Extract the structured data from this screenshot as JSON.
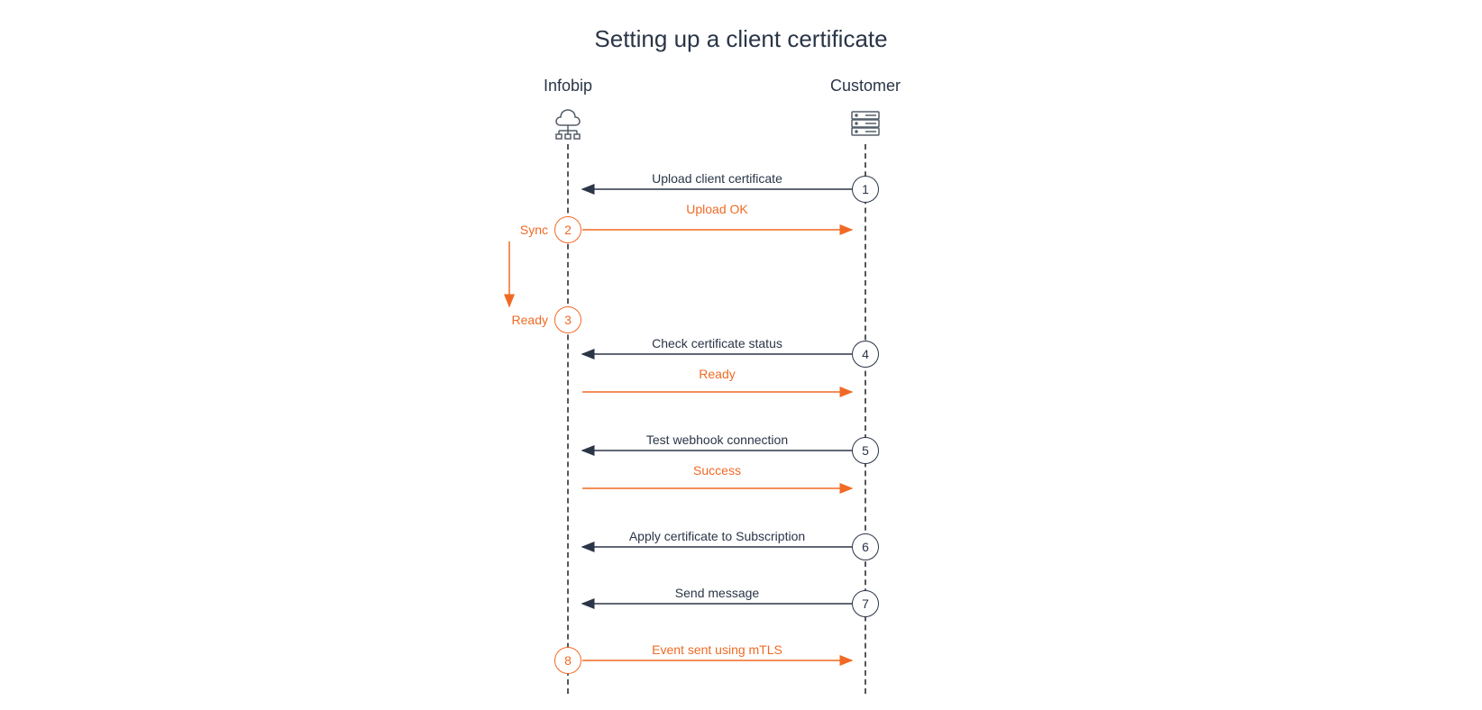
{
  "title": "Setting up a client certificate",
  "actors": {
    "left": "Infobip",
    "right": "Customer"
  },
  "steps": {
    "s1": "1",
    "s2": "2",
    "s3": "3",
    "s4": "4",
    "s5": "5",
    "s6": "6",
    "s7": "7",
    "s8": "8"
  },
  "messages": {
    "m1": "Upload client certificate",
    "m2": "Upload OK",
    "m4a": "Check certificate status",
    "m4b": "Ready",
    "m5a": "Test webhook connection",
    "m5b": "Success",
    "m6": "Apply certificate to Subscription",
    "m7": "Send message",
    "m8": "Event sent using mTLS"
  },
  "self": {
    "sync": "Sync",
    "ready": "Ready"
  },
  "colors": {
    "dark": "#2a3547",
    "orange": "#f06a25"
  },
  "layout": {
    "leftX": 630,
    "rightX": 960
  }
}
